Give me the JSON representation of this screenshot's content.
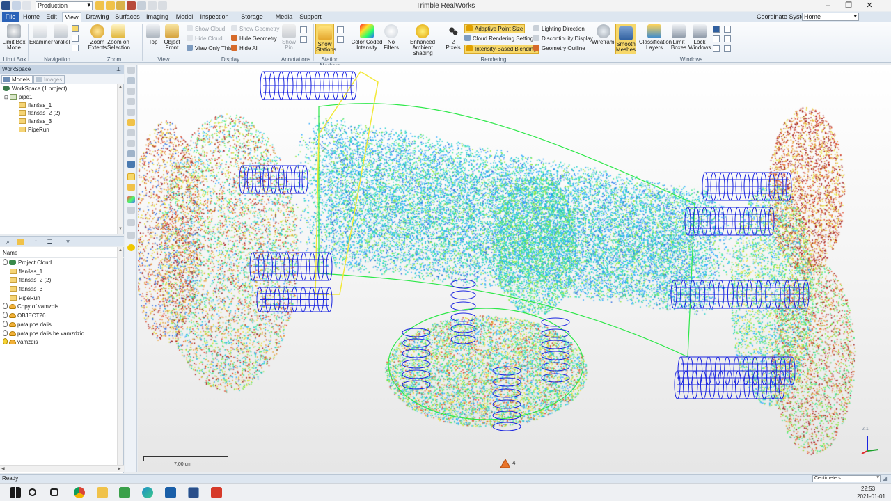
{
  "app": {
    "title": "Trimble RealWorks",
    "project_select": "Production",
    "window_controls": [
      "–",
      "❐",
      "✕"
    ]
  },
  "tabs": [
    "File",
    "Home",
    "Edit",
    "View",
    "Drawing",
    "Surfaces",
    "Imaging",
    "Model",
    "Inspection",
    "Storage Tank",
    "Media",
    "Support"
  ],
  "coordinate_system": {
    "label": "Coordinate System",
    "value": "Home"
  },
  "ribbon": {
    "limit_box": {
      "label1": "Limit Box",
      "label2": "Mode",
      "group": "Limit Box"
    },
    "navigation": {
      "examiner": "Examiner",
      "parallel": "Parallel",
      "group": "Navigation"
    },
    "zoom": {
      "extents1": "Zoom",
      "extents2": "Extents",
      "selection1": "Zoom on",
      "selection2": "Selection",
      "group": "Zoom"
    },
    "view": {
      "top": "Top",
      "object1": "Object",
      "object2": "Front",
      "group": "View"
    },
    "display": {
      "show_cloud": "Show Cloud",
      "hide_cloud": "Hide Cloud",
      "view_only_this": "View Only This",
      "show_geometry": "Show Geometry",
      "hide_geometry": "Hide Geometry",
      "hide_all": "Hide All",
      "group": "Display"
    },
    "annotations": {
      "show_pin1": "Show",
      "show_pin2": "Pin",
      "group": "Annotations"
    },
    "station_markers": {
      "show1": "Show",
      "show2": "Stations",
      "group": "Station Markers"
    },
    "rendering": {
      "color_coded1": "Color Coded",
      "color_coded2": "Intensity",
      "filters1": "No",
      "filters2": "Filters",
      "shading1": "Enhanced Ambient",
      "shading2": "Shading",
      "pixels1": "2",
      "pixels2": "Pixels",
      "adaptive": "Adaptive Point Size",
      "cloud_settings": "Cloud Rendering Settings",
      "blending": "Intensity-Based Blending",
      "lighting": "Lighting Direction",
      "discontinuity": "Discontinuity Display",
      "outline": "Geometry Outline",
      "wireframe": "Wireframe",
      "smooth1": "Smooth",
      "smooth2": "Meshes",
      "group": "Rendering"
    },
    "windows": {
      "classification1": "Classification",
      "classification2": "Layers",
      "limit1": "Limit",
      "limit2": "Boxes",
      "lock1": "Lock",
      "lock2": "Windows",
      "group": "Windows"
    }
  },
  "workspace": {
    "header": "WorkSpace",
    "tabs": [
      "Models",
      "Images"
    ],
    "tree": [
      {
        "label": "WorkSpace  (1 project)",
        "level": 0
      },
      {
        "label": "pipe1",
        "level": 1
      },
      {
        "label": "flanšas_1",
        "level": 2
      },
      {
        "label": "flanšas_2 (2)",
        "level": 2
      },
      {
        "label": "flanšas_3",
        "level": 2
      },
      {
        "label": "PipeRun",
        "level": 2
      }
    ]
  },
  "object_tree": {
    "header": "Name",
    "items": [
      {
        "label": "Project Cloud",
        "kind": "cloud-bulb"
      },
      {
        "label": "flanšas_1",
        "kind": "folder"
      },
      {
        "label": "flanšas_2 (2)",
        "kind": "folder"
      },
      {
        "label": "flanšas_3",
        "kind": "folder"
      },
      {
        "label": "PipeRun",
        "kind": "folder"
      },
      {
        "label": "Copy of vamzdis",
        "kind": "cloud"
      },
      {
        "label": "OBJECT26",
        "kind": "cloud"
      },
      {
        "label": "patalpos dalis",
        "kind": "cloud"
      },
      {
        "label": "patalpos dalis be vamzdzio",
        "kind": "cloud"
      },
      {
        "label": "vamzdis",
        "kind": "cloud-on"
      }
    ]
  },
  "viewport": {
    "scale_label": "7.00 cm",
    "marker_count": "4",
    "axis_label": "2.1"
  },
  "status": {
    "text": "Ready",
    "units": "Centimeters"
  },
  "taskbar": {
    "time": "22:53",
    "date": "2021-01-01"
  },
  "colors": {
    "accent": "#2a62b8",
    "ribbon_highlight": "#f7d86a",
    "wire_blue": "#1a24e0",
    "wire_green": "#2ee84a",
    "wire_yellow": "#f2e83a"
  }
}
